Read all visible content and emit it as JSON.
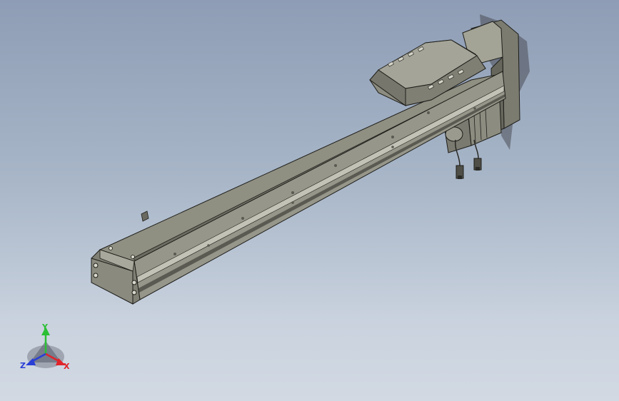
{
  "viewport": {
    "background_top": "#8e9db5",
    "background_bottom": "#d2d9e3"
  },
  "model": {
    "name_icon": "linear-actuator-module",
    "body_color": "#8f8f82",
    "body_dark": "#5e5e55",
    "body_light": "#b3b3a6",
    "edge_color": "#1e1e1a"
  },
  "triad": {
    "x_label": "X",
    "y_label": "Y",
    "z_label": "Z",
    "x_color": "#e0242a",
    "y_color": "#2bbf35",
    "z_color": "#2a3fd6"
  }
}
